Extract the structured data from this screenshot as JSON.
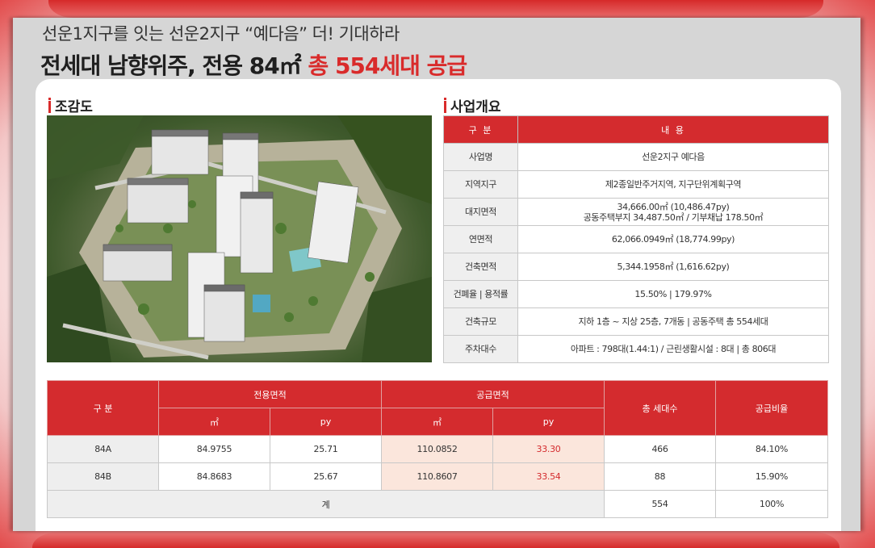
{
  "header": {
    "subtitle": "선운1지구를 잇는 선운2지구 “예다음” 더! 기대하라",
    "title_main": "전세대 남향위주, 전용 84㎡ ",
    "title_highlight": "총 554세대 공급"
  },
  "sections": {
    "aerial_title": "조감도",
    "overview_title": "사업개요"
  },
  "overview": {
    "headers": [
      "구 분",
      "내 용"
    ],
    "rows": [
      {
        "label": "사업명",
        "value": "선운2지구 예다음",
        "value2": ""
      },
      {
        "label": "지역지구",
        "value": "제2종일반주거지역, 지구단위계획구역",
        "value2": ""
      },
      {
        "label": "대지면적",
        "value": "34,666.00㎡ (10,486.47py)",
        "value2": "공동주택부지 34,487.50㎡ / 기부채납 178.50㎡"
      },
      {
        "label": "연면적",
        "value": "62,066.0949㎡ (18,774.99py)",
        "value2": ""
      },
      {
        "label": "건축면적",
        "value": "5,344.1958㎡ (1,616.62py)",
        "value2": ""
      },
      {
        "label": "건폐율 | 용적률",
        "value": "15.50% | 179.97%",
        "value2": ""
      },
      {
        "label": "건축규모",
        "value": "지하 1층 ~ 지상 25층, 7개동 | 공동주택 총 554세대",
        "value2": ""
      },
      {
        "label": "주차대수",
        "value": "아파트 : 798대(1.44:1) / 근린생활시설 : 8대 | 총 806대",
        "value2": ""
      }
    ]
  },
  "supply": {
    "headers": {
      "type": "구 분",
      "exclusive": "전용면적",
      "supply": "공급면적",
      "households": "총 세대수",
      "ratio": "공급비율",
      "sqm": "㎡",
      "py": "py"
    },
    "rows": [
      {
        "type": "84A",
        "ex_sqm": "84.9755",
        "ex_py": "25.71",
        "sp_sqm": "110.0852",
        "sp_py": "33.30",
        "households": "466",
        "ratio": "84.10%"
      },
      {
        "type": "84B",
        "ex_sqm": "84.8683",
        "ex_py": "25.67",
        "sp_sqm": "110.8607",
        "sp_py": "33.54",
        "households": "88",
        "ratio": "15.90%"
      }
    ],
    "total": {
      "label": "계",
      "households": "554",
      "ratio": "100%"
    }
  },
  "colors": {
    "accent": "#d42b2e",
    "highlight_cell": "#fbe6dc",
    "label_cell": "#efefef"
  }
}
